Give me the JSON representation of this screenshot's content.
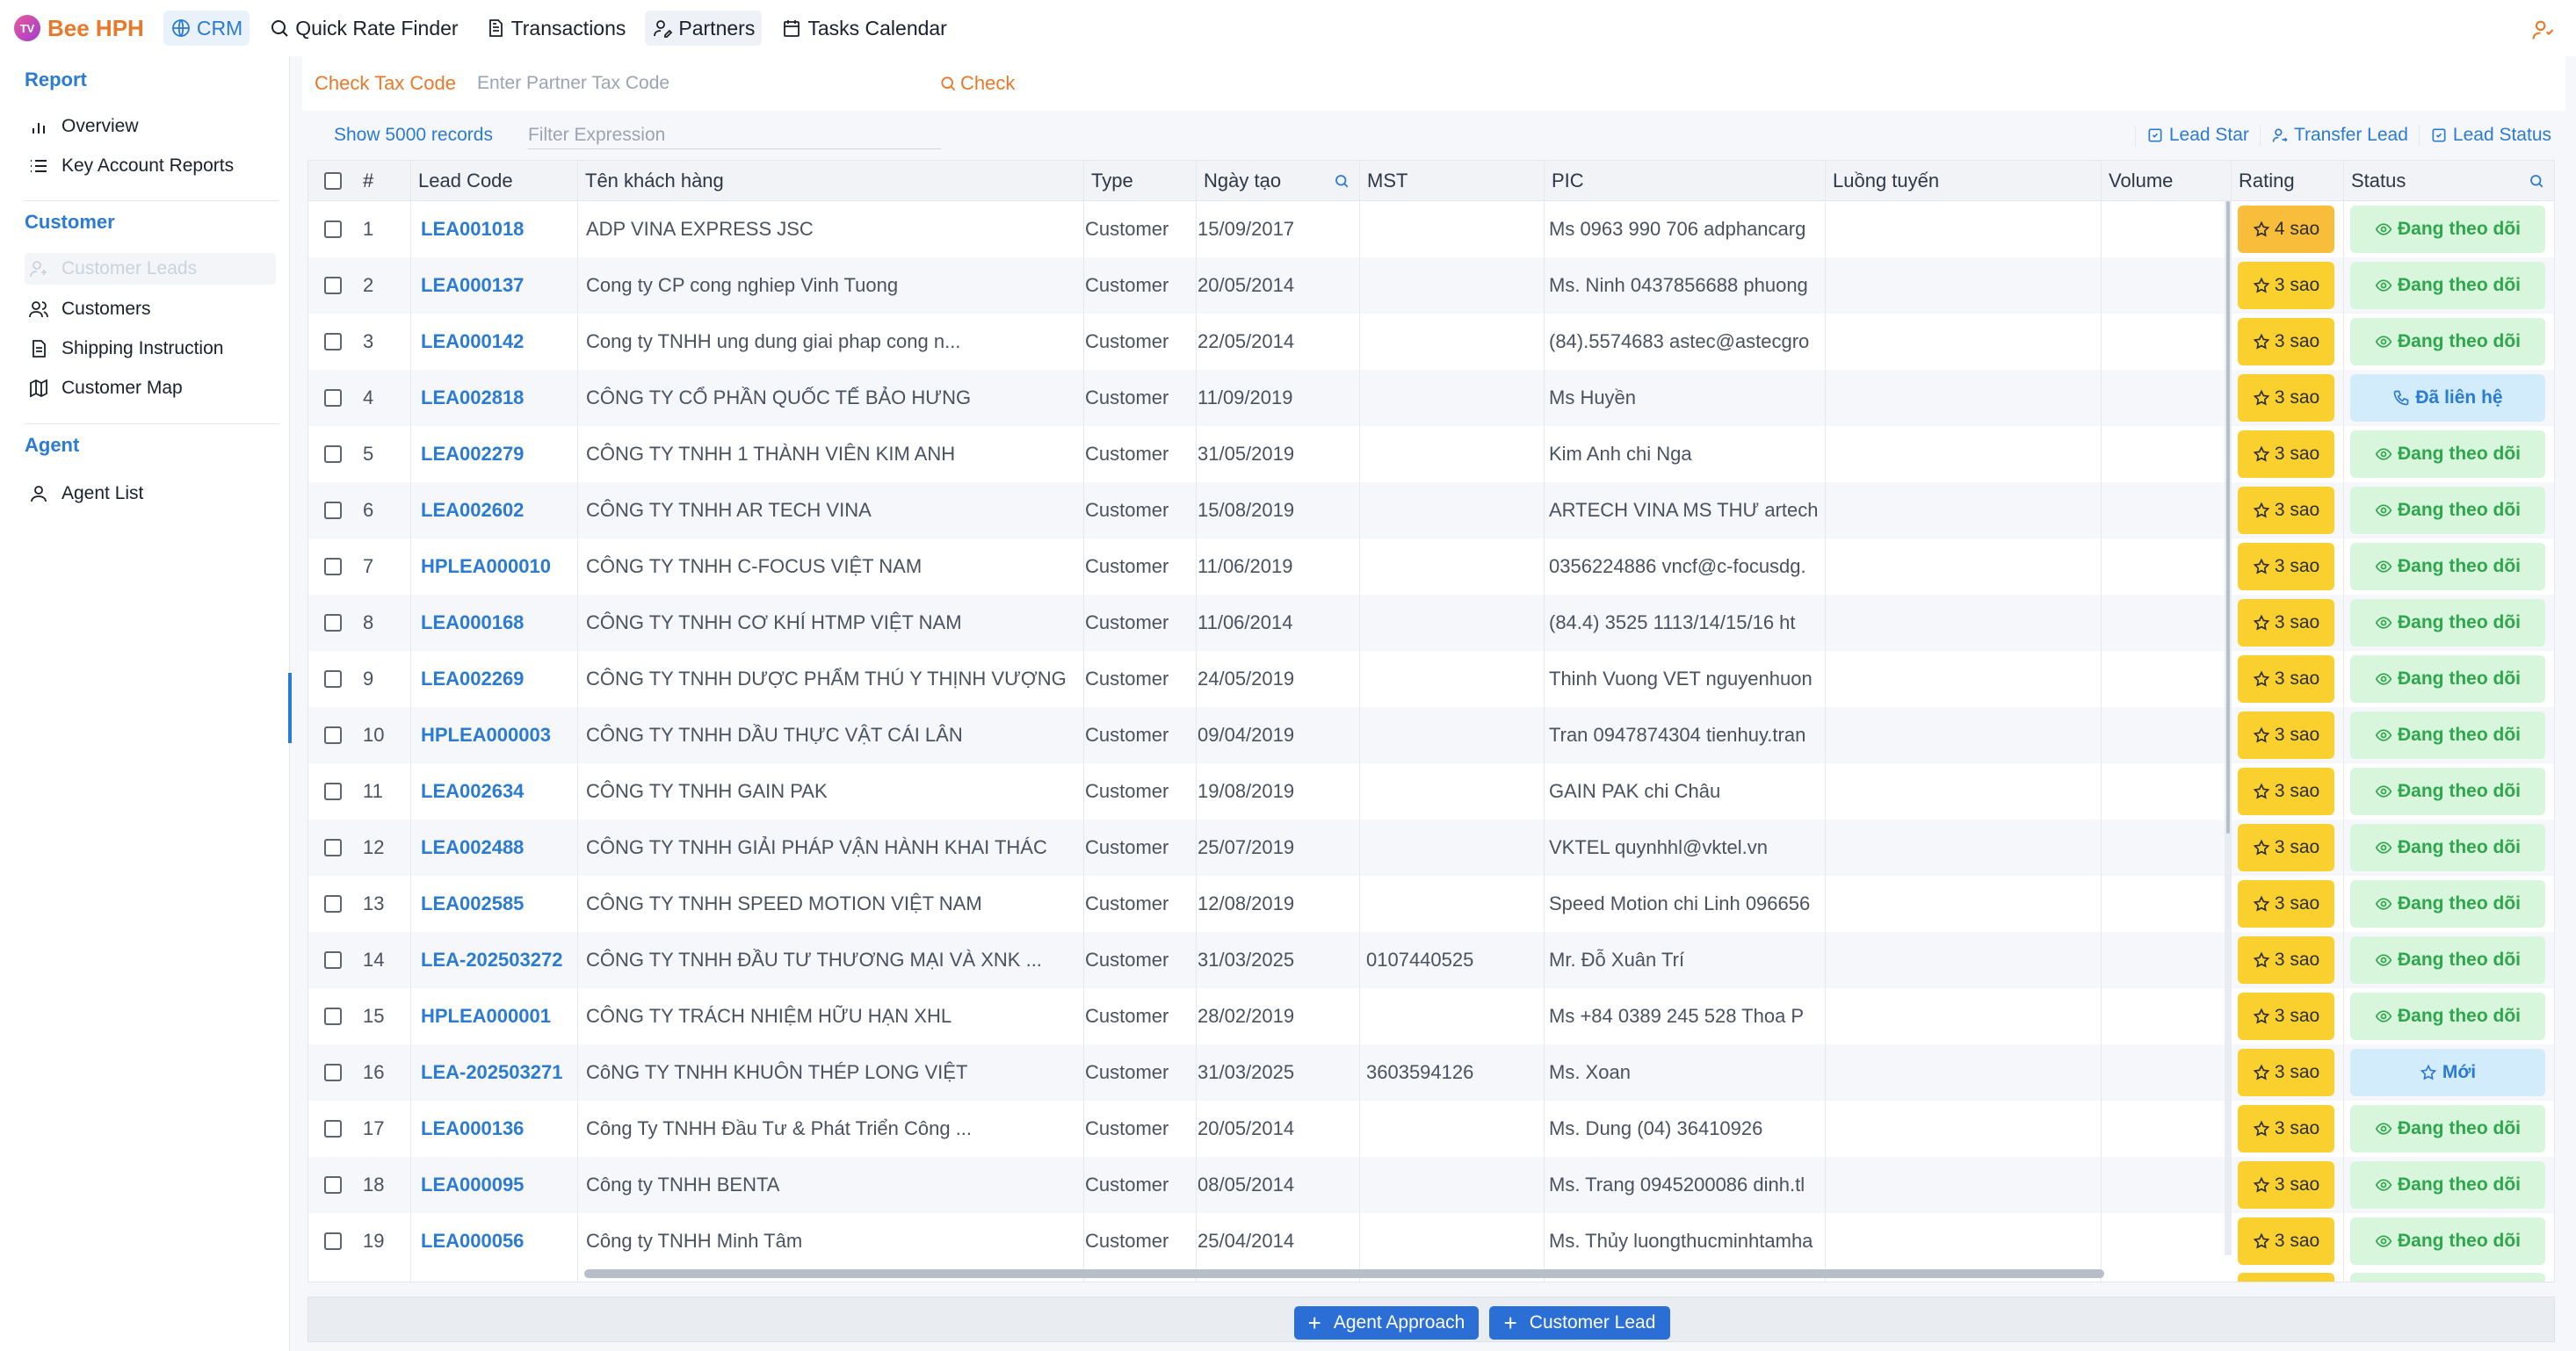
{
  "brand": {
    "logo": "TV",
    "name": "Bee HPH"
  },
  "nav": {
    "crm": "CRM",
    "quick_rate": "Quick Rate Finder",
    "transactions": "Transactions",
    "partners": "Partners",
    "tasks": "Tasks Calendar"
  },
  "sidebar": {
    "report_title": "Report",
    "overview": "Overview",
    "key_accounts": "Key Account Reports",
    "customer_title": "Customer",
    "customer_leads": "Customer Leads",
    "customers": "Customers",
    "shipping": "Shipping Instruction",
    "map": "Customer Map",
    "agent_title": "Agent",
    "agent_list": "Agent List"
  },
  "taxbar": {
    "label": "Check Tax Code",
    "placeholder": "Enter Partner Tax Code",
    "check": "Check"
  },
  "filter": {
    "show_records": "Show 5000 records",
    "placeholder": "Filter Expression"
  },
  "actions": {
    "lead_star": "Lead Star",
    "transfer_lead": "Transfer Lead",
    "lead_status": "Lead Status"
  },
  "table": {
    "headers": {
      "index": "#",
      "lead_code": "Lead Code",
      "customer_name": "Tên khách hàng",
      "type": "Type",
      "created": "Ngày tạo",
      "tax": "MST",
      "pic": "PIC",
      "route": "Luồng tuyến",
      "volume": "Volume",
      "rating": "Rating",
      "status": "Status"
    },
    "rows": [
      {
        "no": "1",
        "code": "LEA001018",
        "name": "ADP VINA EXPRESS JSC",
        "type": "Customer",
        "date": "15/09/2017",
        "mst": "",
        "pic": "Ms 0963 990 706 adphancarg",
        "rating": "4 sao",
        "status": "Đang theo dõi",
        "status_kind": "follow"
      },
      {
        "no": "2",
        "code": "LEA000137",
        "name": "Cong ty CP cong nghiep Vinh Tuong",
        "type": "Customer",
        "date": "20/05/2014",
        "mst": "",
        "pic": "Ms. Ninh 0437856688 phuong",
        "rating": "3 sao",
        "status": "Đang theo dõi",
        "status_kind": "follow"
      },
      {
        "no": "3",
        "code": "LEA000142",
        "name": "Cong ty TNHH ung dung giai phap cong n...",
        "type": "Customer",
        "date": "22/05/2014",
        "mst": "",
        "pic": "(84).5574683 astec@astecgro",
        "rating": "3 sao",
        "status": "Đang theo dõi",
        "status_kind": "follow"
      },
      {
        "no": "4",
        "code": "LEA002818",
        "name": "CÔNG TY CỔ PHẦN QUỐC TẾ BẢO HƯNG",
        "type": "Customer",
        "date": "11/09/2019",
        "mst": "",
        "pic": "Ms Huyền",
        "rating": "3 sao",
        "status": "Đã liên hệ",
        "status_kind": "contacted"
      },
      {
        "no": "5",
        "code": "LEA002279",
        "name": "CÔNG TY TNHH 1 THÀNH VIÊN KIM ANH",
        "type": "Customer",
        "date": "31/05/2019",
        "mst": "",
        "pic": "Kim Anh chi Nga",
        "rating": "3 sao",
        "status": "Đang theo dõi",
        "status_kind": "follow"
      },
      {
        "no": "6",
        "code": "LEA002602",
        "name": "CÔNG TY TNHH AR TECH VINA",
        "type": "Customer",
        "date": "15/08/2019",
        "mst": "",
        "pic": "ARTECH VINA MS THƯ artech",
        "rating": "3 sao",
        "status": "Đang theo dõi",
        "status_kind": "follow"
      },
      {
        "no": "7",
        "code": "HPLEA000010",
        "name": "CÔNG TY TNHH C-FOCUS VIỆT NAM",
        "type": "Customer",
        "date": "11/06/2019",
        "mst": "",
        "pic": "0356224886 vncf@c-focusdg.",
        "rating": "3 sao",
        "status": "Đang theo dõi",
        "status_kind": "follow"
      },
      {
        "no": "8",
        "code": "LEA000168",
        "name": "CÔNG TY TNHH CƠ KHÍ HTMP VIỆT NAM",
        "type": "Customer",
        "date": "11/06/2014",
        "mst": "",
        "pic": "(84.4) 3525 1113/14/15/16 ht",
        "rating": "3 sao",
        "status": "Đang theo dõi",
        "status_kind": "follow"
      },
      {
        "no": "9",
        "code": "LEA002269",
        "name": "CÔNG TY TNHH DƯỢC PHẨM THÚ Y THỊNH VƯỢNG",
        "type": "Customer",
        "date": "24/05/2019",
        "mst": "",
        "pic": "Thinh Vuong VET nguyenhuon",
        "rating": "3 sao",
        "status": "Đang theo dõi",
        "status_kind": "follow"
      },
      {
        "no": "10",
        "code": "HPLEA000003",
        "name": "CÔNG TY TNHH DẦU THỰC VẬT CÁI LÂN",
        "type": "Customer",
        "date": "09/04/2019",
        "mst": "",
        "pic": "Tran 0947874304 tienhuy.tran",
        "rating": "3 sao",
        "status": "Đang theo dõi",
        "status_kind": "follow"
      },
      {
        "no": "11",
        "code": "LEA002634",
        "name": "CÔNG TY TNHH GAIN PAK",
        "type": "Customer",
        "date": "19/08/2019",
        "mst": "",
        "pic": "GAIN PAK chi Châu",
        "rating": "3 sao",
        "status": "Đang theo dõi",
        "status_kind": "follow"
      },
      {
        "no": "12",
        "code": "LEA002488",
        "name": "CÔNG TY TNHH GIẢI PHÁP VẬN HÀNH KHAI THÁC",
        "type": "Customer",
        "date": "25/07/2019",
        "mst": "",
        "pic": "VKTEL quynhhl@vktel.vn",
        "rating": "3 sao",
        "status": "Đang theo dõi",
        "status_kind": "follow"
      },
      {
        "no": "13",
        "code": "LEA002585",
        "name": "CÔNG TY TNHH SPEED MOTION VIỆT NAM",
        "type": "Customer",
        "date": "12/08/2019",
        "mst": "",
        "pic": "Speed Motion chi Linh 096656",
        "rating": "3 sao",
        "status": "Đang theo dõi",
        "status_kind": "follow"
      },
      {
        "no": "14",
        "code": "LEA-202503272",
        "name": "CÔNG TY TNHH ĐẦU TƯ THƯƠNG MẠI VÀ XNK ...",
        "type": "Customer",
        "date": "31/03/2025",
        "mst": "0107440525",
        "pic": "Mr. Đỗ Xuân Trí",
        "rating": "3 sao",
        "status": "Đang theo dõi",
        "status_kind": "follow"
      },
      {
        "no": "15",
        "code": "HPLEA000001",
        "name": "CÔNG TY TRÁCH NHIỆM HỮU HẠN XHL",
        "type": "Customer",
        "date": "28/02/2019",
        "mst": "",
        "pic": "Ms +84 0389 245 528 Thoa P",
        "rating": "3 sao",
        "status": "Đang theo dõi",
        "status_kind": "follow"
      },
      {
        "no": "16",
        "code": "LEA-202503271",
        "name": "CôNG TY TNHH KHUÔN THÉP LONG VIỆT",
        "type": "Customer",
        "date": "31/03/2025",
        "mst": "3603594126",
        "pic": "Ms. Xoan",
        "rating": "3 sao",
        "status": "Mới",
        "status_kind": "new"
      },
      {
        "no": "17",
        "code": "LEA000136",
        "name": "Công Ty TNHH Đầu Tư & Phát Triển Công ...",
        "type": "Customer",
        "date": "20/05/2014",
        "mst": "",
        "pic": "Ms. Dung (04) 36410926",
        "rating": "3 sao",
        "status": "Đang theo dõi",
        "status_kind": "follow"
      },
      {
        "no": "18",
        "code": "LEA000095",
        "name": "Công ty TNHH BENTA",
        "type": "Customer",
        "date": "08/05/2014",
        "mst": "",
        "pic": "Ms. Trang 0945200086 dinh.tl",
        "rating": "3 sao",
        "status": "Đang theo dõi",
        "status_kind": "follow"
      },
      {
        "no": "19",
        "code": "LEA000056",
        "name": "Công ty TNHH Minh Tâm",
        "type": "Customer",
        "date": "25/04/2014",
        "mst": "",
        "pic": "Ms. Thủy luongthucminhtamha",
        "rating": "3 sao",
        "status": "Đang theo dõi",
        "status_kind": "follow"
      }
    ]
  },
  "footer": {
    "agent_approach": "Agent Approach",
    "customer_lead": "Customer Lead"
  },
  "colors": {
    "accent": "#2b7bd3",
    "brand": "#e8792a",
    "rating": "#fad02e",
    "follow_bg": "#d7f6dc",
    "follow_text": "#2ea64b"
  }
}
